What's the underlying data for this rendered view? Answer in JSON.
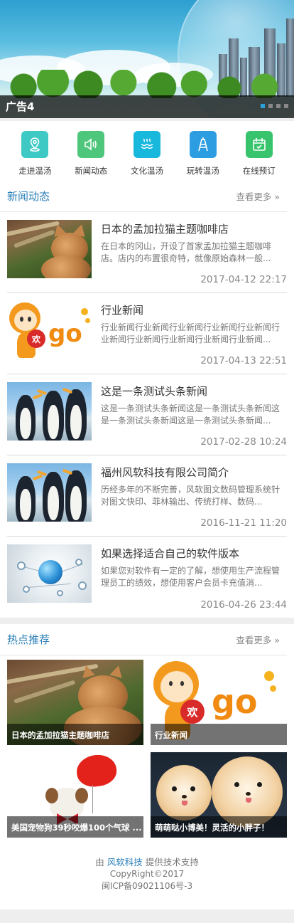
{
  "banner": {
    "caption": "广告4",
    "slide_count": 4,
    "active_slide": 1
  },
  "icon_nav": [
    {
      "label": "走进温汤",
      "icon": "map-pin-icon",
      "color": "#3ec9c4"
    },
    {
      "label": "新闻动态",
      "icon": "speaker-icon",
      "color": "#4ec77c"
    },
    {
      "label": "文化温汤",
      "icon": "hot-spring-icon",
      "color": "#18b8dc"
    },
    {
      "label": "玩转温汤",
      "icon": "tower-icon",
      "color": "#2b9de0"
    },
    {
      "label": "在线预订",
      "icon": "calendar-icon",
      "color": "#37c46c"
    }
  ],
  "news": {
    "title": "新闻动态",
    "more": "查看更多 »",
    "items": [
      {
        "title": "日本的孟加拉猫主题咖啡店",
        "desc": "在日本的冈山，开设了首家孟加拉猫主题咖啡店。店内的布置很奇特，就像原始森林一般...",
        "date": "2017-04-12 22:17",
        "image": "cat"
      },
      {
        "title": "行业新闻",
        "desc": "行业新闻行业新闻行业新闻行业新闻行业新闻行业新闻行业新闻行业新闻行业新闻行业新闻...",
        "date": "2017-04-13 22:51",
        "image": "huango"
      },
      {
        "title": "这是一条测试头条新闻",
        "desc": "这是一条测试头条新闻这是一条测试头条新闻这是一条测试头条新闻这是一条测试头条新闻...",
        "date": "2017-02-28 10:24",
        "image": "penguins"
      },
      {
        "title": "福州风软科技有限公司简介",
        "desc": "历经多年的不断完善，风软图文数码管理系统针对图文快印、菲林输出、传统打样、数码...",
        "date": "2016-11-21 11:20",
        "image": "penguins"
      },
      {
        "title": "如果选择适合自己的软件版本",
        "desc": "如果您对软件有一定的了解，想使用生产流程管理员工的绩效，想使用客户会员卡充值消...",
        "date": "2016-04-26 23:44",
        "image": "network"
      }
    ]
  },
  "hot": {
    "title": "热点推荐",
    "more": "查看更多 »",
    "items": [
      {
        "caption": "日本的孟加拉猫主题咖啡店",
        "image": "cat"
      },
      {
        "caption": "行业新闻",
        "image": "huango"
      },
      {
        "caption": "美国宠物狗39秒咬爆100个气球 ...",
        "image": "dog-balloon"
      },
      {
        "caption": "萌萌哒小博美！灵活的小胖子！",
        "image": "pomeranians"
      }
    ]
  },
  "footer": {
    "prefix": "由 ",
    "brand": "风软科技",
    "suffix": " 提供技术支持",
    "copyright": "CopyRight©2017",
    "icp": "闽ICP备09021106号-3"
  }
}
